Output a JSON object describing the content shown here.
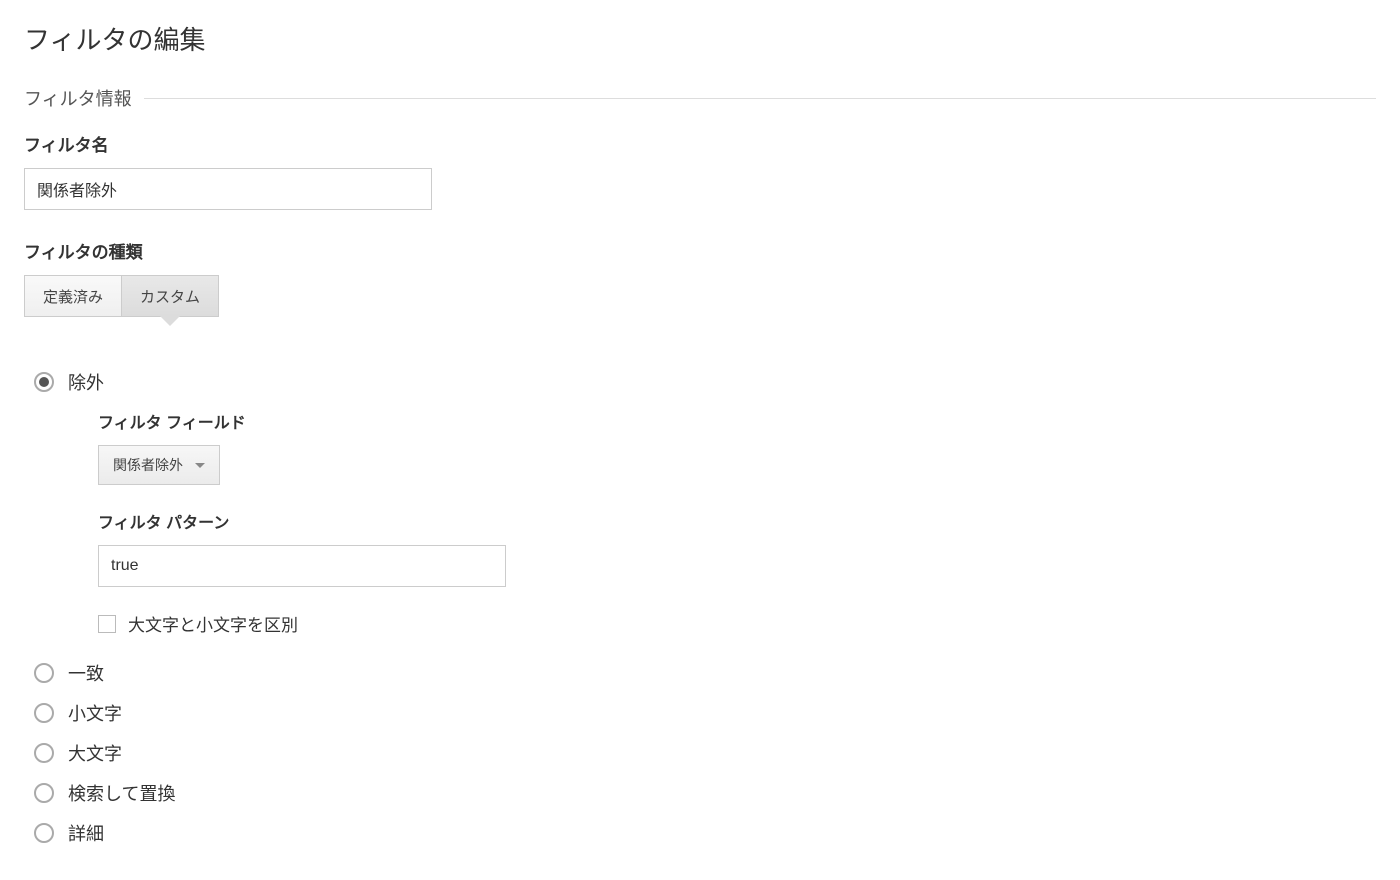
{
  "page": {
    "title": "フィルタの編集"
  },
  "section": {
    "header": "フィルタ情報"
  },
  "filterName": {
    "label": "フィルタ名",
    "value": "関係者除外"
  },
  "filterType": {
    "label": "フィルタの種類",
    "options": {
      "predefined": "定義済み",
      "custom": "カスタム"
    },
    "selected": "custom"
  },
  "customFilter": {
    "radios": {
      "exclude": "除外",
      "include": "一致",
      "lowercase": "小文字",
      "uppercase": "大文字",
      "searchReplace": "検索して置換",
      "advanced": "詳細"
    },
    "selected": "exclude"
  },
  "excludeFields": {
    "filterField": {
      "label": "フィルタ フィールド",
      "value": "関係者除外"
    },
    "filterPattern": {
      "label": "フィルタ パターン",
      "value": "true"
    },
    "caseSensitive": {
      "label": "大文字と小文字を区別",
      "checked": false
    }
  }
}
